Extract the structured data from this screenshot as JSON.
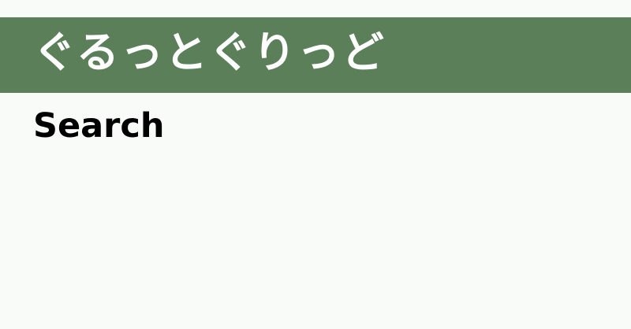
{
  "header": {
    "site_title": "ぐるっとぐりっど",
    "background_color": "#5b7f59",
    "text_color": "#ffffff"
  },
  "main": {
    "heading": "Search"
  },
  "page": {
    "background_color": "#f9fbf9"
  }
}
